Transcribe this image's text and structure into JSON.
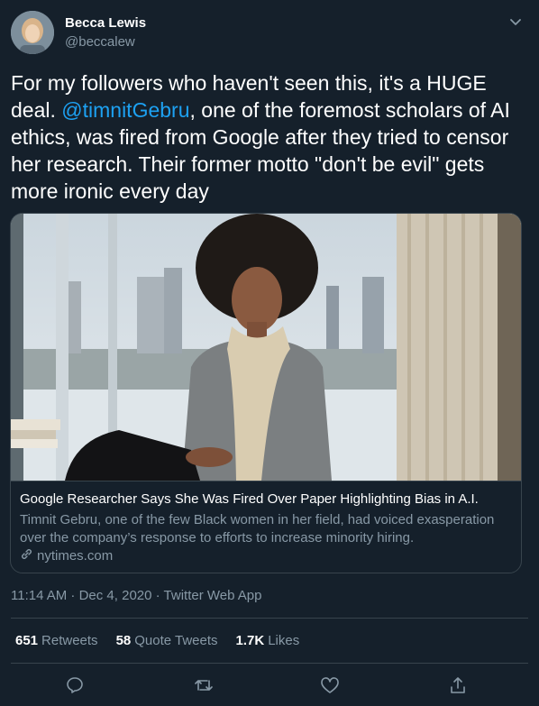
{
  "author": {
    "display_name": "Becca Lewis",
    "handle": "@beccalew"
  },
  "tweet": {
    "text_part1": "For my followers who haven't seen this, it's a HUGE deal. ",
    "mention": "@timnitGebru",
    "text_part2": ", one of the foremost scholars of AI ethics, was fired from Google after they tried to censor her research. Their former motto \"don't be evil\" gets more ironic every day"
  },
  "card": {
    "title": "Google Researcher Says She Was Fired Over Paper Highlighting Bias in A.I.",
    "description": "Timnit Gebru, one of the few Black women in her field, had voiced exasperation over the company’s response to efforts to increase minority hiring.",
    "domain": "nytimes.com"
  },
  "meta": {
    "timestamp": "11:14 AM · Dec 4, 2020 · Twitter Web App"
  },
  "stats": {
    "retweets_count": "651",
    "retweets_label": "Retweets",
    "quotes_count": "58",
    "quotes_label": "Quote Tweets",
    "likes_count": "1.7K",
    "likes_label": "Likes"
  },
  "icons": {
    "reply": "reply-icon",
    "retweet": "retweet-icon",
    "like": "like-icon",
    "share": "share-icon",
    "caret": "chevron-down-icon",
    "link": "link-icon"
  },
  "colors": {
    "background": "#15202b",
    "accent": "#1da1f2",
    "muted": "#8899a6",
    "border": "#38444d"
  }
}
